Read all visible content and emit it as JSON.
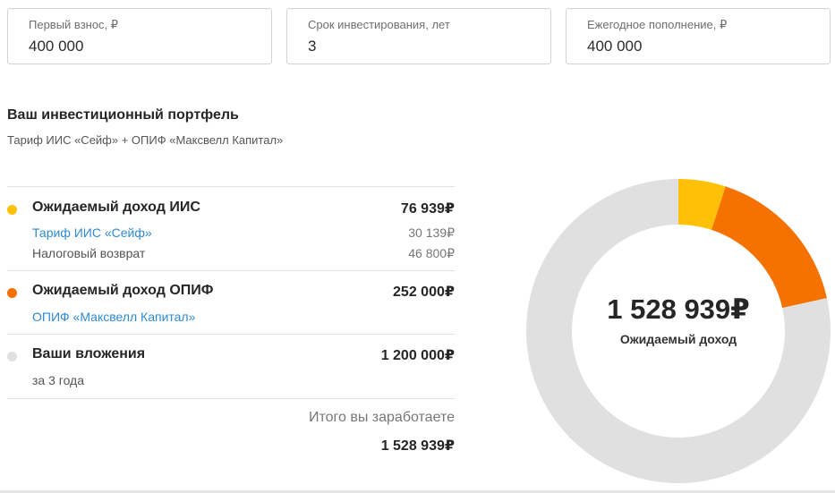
{
  "inputs": [
    {
      "label": "Первый взнос, ₽",
      "value": "400 000"
    },
    {
      "label": "Срок инвестирования, лет",
      "value": "3"
    },
    {
      "label": "Ежегодное пополнение, ₽",
      "value": "400 000"
    }
  ],
  "portfolio": {
    "title": "Ваш инвестиционный портфель",
    "subtitle": "Тариф ИИС «Сейф» + ОПИФ «Максвелл Капитал»"
  },
  "rows": {
    "iis": {
      "label": "Ожидаемый доход ИИС",
      "value": "76 939₽",
      "color": "#ffc107",
      "tariff_link": "Тариф ИИС «Сейф»",
      "tariff_value": "30 139₽",
      "tax_label": "Налоговый возврат",
      "tax_value": "46 800₽"
    },
    "opif": {
      "label": "Ожидаемый доход ОПИФ",
      "value": "252 000₽",
      "color": "#f57100",
      "fund_link": "ОПИФ «Максвелл Капитал»"
    },
    "invest": {
      "label": "Ваши вложения",
      "value": "1 200 000₽",
      "color": "#e0e0e0",
      "period": "за 3 года"
    }
  },
  "total": {
    "label": "Итого вы заработаете",
    "value": "1 528 939₽"
  },
  "donut": {
    "center_value": "1 528 939₽",
    "center_label": "Ожидаемый доход"
  },
  "chart_data": {
    "type": "pie",
    "categories": [
      "Ожидаемый доход ИИС",
      "Ожидаемый доход ОПИФ",
      "Ваши вложения"
    ],
    "values": [
      76939,
      252000,
      1200000
    ],
    "colors": [
      "#ffc107",
      "#f57100",
      "#e0e0e0"
    ]
  }
}
